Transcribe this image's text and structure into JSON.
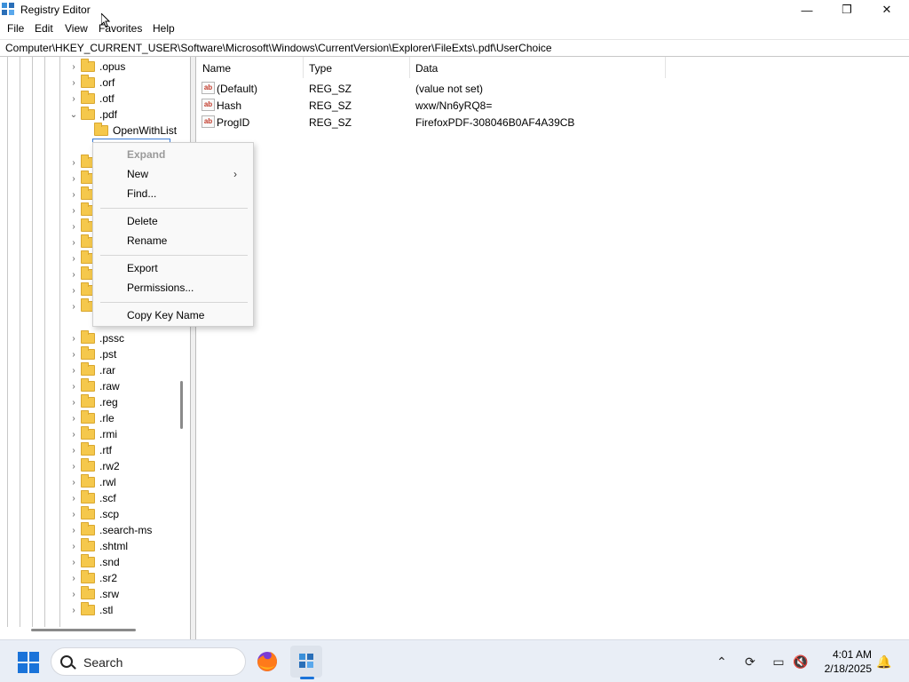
{
  "window": {
    "title": "Registry Editor",
    "controls": {
      "minimize": "—",
      "maximize": "❐",
      "close": "✕"
    }
  },
  "menubar": {
    "items": [
      "File",
      "Edit",
      "View",
      "Favorites",
      "Help"
    ]
  },
  "address": {
    "path": "Computer\\HKEY_CURRENT_USER\\Software\\Microsoft\\Windows\\CurrentVersion\\Explorer\\FileExts\\.pdf\\UserChoice"
  },
  "tree": {
    "items": [
      {
        "label": ".opus",
        "expander": "›"
      },
      {
        "label": ".orf",
        "expander": "›"
      },
      {
        "label": ".otf",
        "expander": "›"
      },
      {
        "label": ".pdf",
        "expander": "⌄"
      },
      {
        "label": "OpenWithList",
        "expander": ""
      },
      {
        "label": ".pssc",
        "expander": "›"
      },
      {
        "label": ".pst",
        "expander": "›"
      },
      {
        "label": ".rar",
        "expander": "›"
      },
      {
        "label": ".raw",
        "expander": "›"
      },
      {
        "label": ".reg",
        "expander": "›"
      },
      {
        "label": ".rle",
        "expander": "›"
      },
      {
        "label": ".rmi",
        "expander": "›"
      },
      {
        "label": ".rtf",
        "expander": "›"
      },
      {
        "label": ".rw2",
        "expander": "›"
      },
      {
        "label": ".rwl",
        "expander": "›"
      },
      {
        "label": ".scf",
        "expander": "›"
      },
      {
        "label": ".scp",
        "expander": "›"
      },
      {
        "label": ".search-ms",
        "expander": "›"
      },
      {
        "label": ".shtml",
        "expander": "›"
      },
      {
        "label": ".snd",
        "expander": "›"
      },
      {
        "label": ".sr2",
        "expander": "›"
      },
      {
        "label": ".srw",
        "expander": "›"
      },
      {
        "label": ".stl",
        "expander": "›"
      }
    ],
    "hidden_rows_expander": "›"
  },
  "list": {
    "columns": [
      "Name",
      "Type",
      "Data"
    ],
    "rows": [
      {
        "name": "(Default)",
        "type": "REG_SZ",
        "data": "(value not set)",
        "icon": "ab"
      },
      {
        "name": "Hash",
        "type": "REG_SZ",
        "data": "wxw/Nn6yRQ8=",
        "icon": "ab"
      },
      {
        "name": "ProgID",
        "type": "REG_SZ",
        "data": "FirefoxPDF-308046B0AF4A39CB",
        "icon": "ab"
      }
    ]
  },
  "context_menu": {
    "items": [
      {
        "label": "Expand",
        "disabled": true
      },
      {
        "label": "New",
        "submenu": "›"
      },
      {
        "label": "Find..."
      },
      {
        "label": "Delete"
      },
      {
        "label": "Rename"
      },
      {
        "label": "Export"
      },
      {
        "label": "Permissions..."
      },
      {
        "label": "Copy Key Name"
      }
    ]
  },
  "taskbar": {
    "search_placeholder": "Search",
    "clock": {
      "time": "4:01 AM",
      "date": "2/18/2025"
    },
    "tray": {
      "chevron": "⌃",
      "sync": "⟳",
      "network": "▭",
      "volume": "🔇",
      "notifications": "🔔"
    }
  },
  "colors": {
    "accent": "#1a73d9",
    "folder": "#f5c84c",
    "taskbar": "#e9eef6"
  }
}
